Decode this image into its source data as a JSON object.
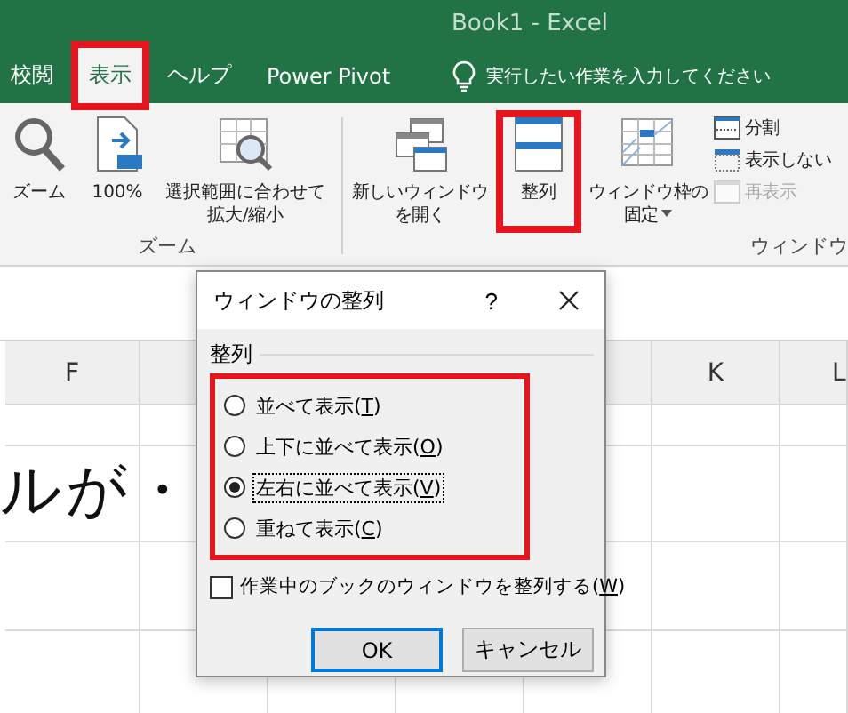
{
  "window": {
    "title": "Book1  -  Excel"
  },
  "tabs": [
    {
      "label": "校閲",
      "selected": false,
      "highlighted": false
    },
    {
      "label": "表示",
      "selected": true,
      "highlighted": true
    },
    {
      "label": "ヘルプ",
      "selected": false,
      "highlighted": false
    },
    {
      "label": "Power Pivot",
      "selected": false,
      "highlighted": false
    }
  ],
  "tell_me": {
    "placeholder": "実行したい作業を入力してください"
  },
  "ribbon": {
    "groups": [
      {
        "label": "ズーム",
        "buttons": [
          {
            "kind": "zoom",
            "label_lines": [
              "ズーム"
            ],
            "highlighted": false
          },
          {
            "kind": "zoom100",
            "label_lines": [
              "100%"
            ],
            "highlighted": false
          },
          {
            "kind": "zoom-selection",
            "label_lines": [
              "選択範囲に合わせて",
              "拡大/縮小"
            ],
            "highlighted": false
          }
        ]
      },
      {
        "label": "ウィンドウ",
        "buttons": [
          {
            "kind": "new-window",
            "label_lines": [
              "新しいウィンドウ",
              "を開く"
            ],
            "highlighted": false
          },
          {
            "kind": "arrange",
            "label_lines": [
              "整列"
            ],
            "highlighted": true
          },
          {
            "kind": "freeze",
            "label_lines": [
              "ウィンドウ枠の",
              "固定"
            ],
            "dropdown": true,
            "highlighted": false
          }
        ],
        "small_buttons": [
          {
            "kind": "split",
            "label": "分割",
            "disabled": false
          },
          {
            "kind": "hide",
            "label": "表示しない",
            "disabled": false
          },
          {
            "kind": "unhide",
            "label": "再表示",
            "disabled": true
          }
        ]
      }
    ]
  },
  "sheet": {
    "columns": [
      {
        "label": "F"
      },
      {
        "label": "K"
      },
      {
        "label": "L"
      }
    ],
    "cell_text": "ルが・"
  },
  "dialog": {
    "title": "ウィンドウの整列",
    "help": "?",
    "group_label": "整列",
    "highlighted": true,
    "options": [
      {
        "label_before": "並べて表示(",
        "access_key": "T",
        "label_after": ")",
        "selected": false,
        "focused": false
      },
      {
        "label_before": "上下に並べて表示(",
        "access_key": "O",
        "label_after": ")",
        "selected": false,
        "focused": false
      },
      {
        "label_before": "左右に並べて表示(",
        "access_key": "V",
        "label_after": ")",
        "selected": true,
        "focused": true
      },
      {
        "label_before": "重ねて表示(",
        "access_key": "C",
        "label_after": ")",
        "selected": false,
        "focused": false
      }
    ],
    "checkbox": {
      "label_before": "作業中のブックのウィンドウを整列する(",
      "access_key": "W",
      "label_after": ")",
      "checked": false
    },
    "buttons": [
      {
        "label": "OK",
        "default": true
      },
      {
        "label": "キャンセル",
        "default": false
      }
    ]
  }
}
